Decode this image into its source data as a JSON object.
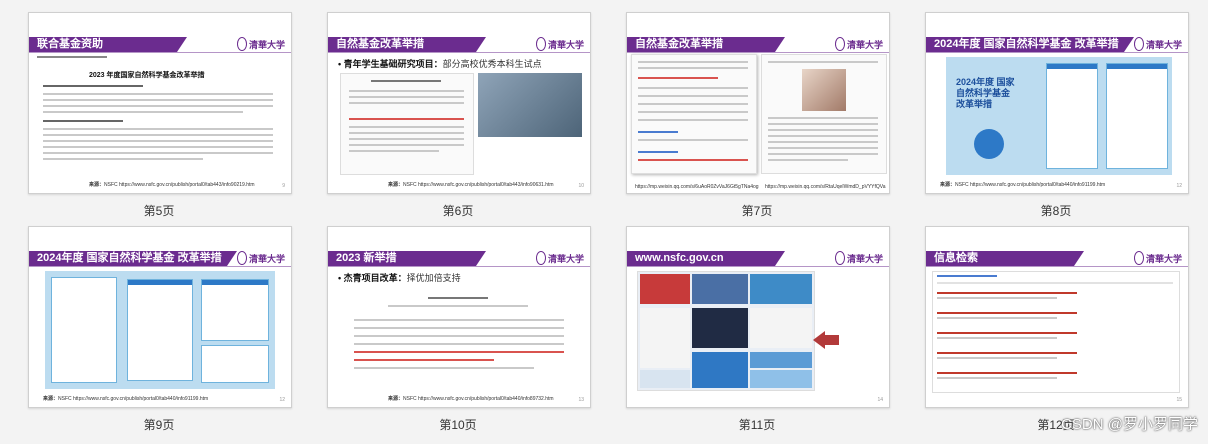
{
  "slides": [
    {
      "title": "联合基金资助",
      "label": "第5页",
      "heading": "2023 年度国家自然科学基金改革举措",
      "source_prefix": "来源：",
      "source": "NSFC https://www.nsfc.gov.cn/publish/portal0/tab443/info90219.htm",
      "page": "9"
    },
    {
      "title": "自然基金改革举措",
      "label": "第6页",
      "heading_bold": "青年学生基础研究项目：",
      "heading_rest": "部分高校优秀本科生试点",
      "source_prefix": "来源：",
      "source": "NSFC https://www.nsfc.gov.cn/publish/portal0/tab443/info90631.htm",
      "page": "10"
    },
    {
      "title": "自然基金改革举措",
      "label": "第7页",
      "url_left": "https://mp.weixin.qq.com/s/6uAoR0ZvVaJ6Gt5gTNa4og",
      "url_right": "https://mp.weixin.qq.com/s/RtaUqeIWmdD_pVYYfQVa",
      "page": "11"
    },
    {
      "title": "2024年度 国家自然科学基金 改革举措",
      "label": "第8页",
      "poster_title": "2024年度 国家自然科学基金 改革举措",
      "source_prefix": "来源：",
      "source": "NSFC https://www.nsfc.gov.cn/publish/portal0/tab440/info91199.htm",
      "page": "12"
    },
    {
      "title": "2024年度 国家自然科学基金 改革举措",
      "label": "第9页",
      "source_prefix": "来源：",
      "source": "NSFC https://www.nsfc.gov.cn/publish/portal0/tab440/info91199.htm",
      "page": "12"
    },
    {
      "title": "2023 新举措",
      "label": "第10页",
      "heading_bold": "杰青项目改革：",
      "heading_rest": "择优加倍支持",
      "source_prefix": "来源：",
      "source": "NSFC https://www.nsfc.gov.cn/publish/portal0/tab440/info89732.htm",
      "page": "13"
    },
    {
      "title": "www.nsfc.gov.cn",
      "label": "第11页",
      "page": "14"
    },
    {
      "title": "信息检索",
      "label": "第12页",
      "page": "15"
    }
  ],
  "logo_text": "清華大学",
  "watermark": "CSDN @罗小罗同学",
  "colors": {
    "accent": "#6b2c8f",
    "arrow": "#b23a3a"
  }
}
